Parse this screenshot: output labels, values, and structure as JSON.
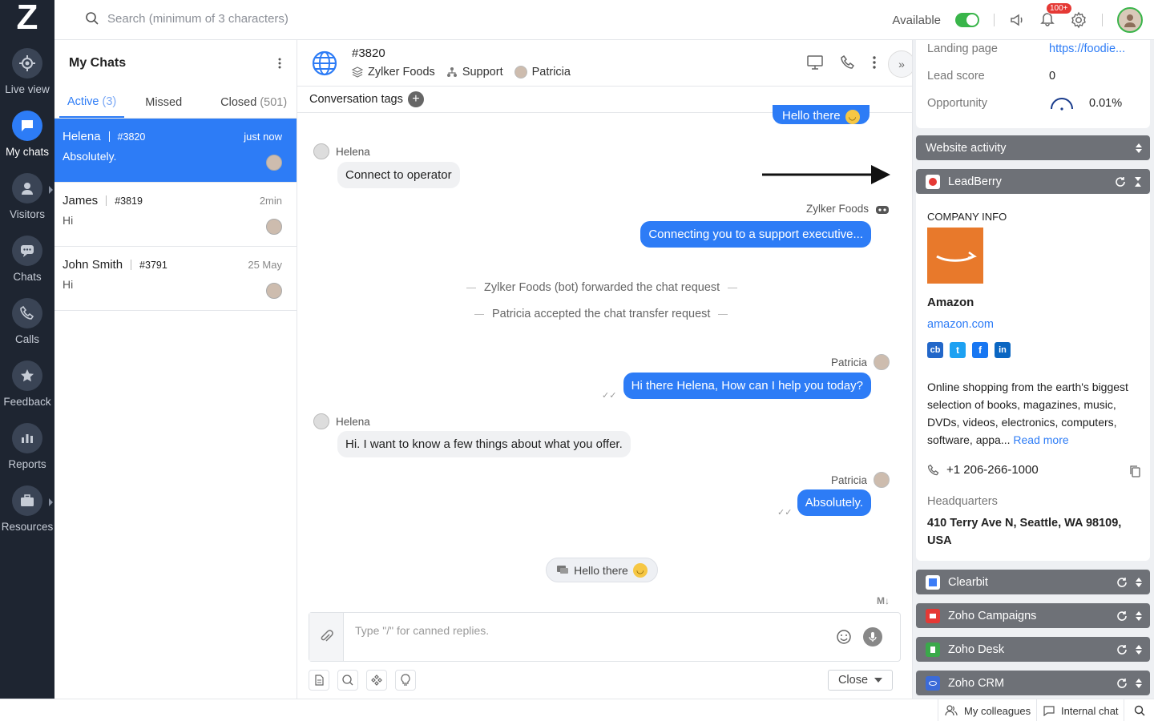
{
  "rail": {
    "logo": "Z",
    "items": [
      {
        "label": "Live view",
        "icon": "crosshair-icon"
      },
      {
        "label": "My chats",
        "icon": "chat-icon"
      },
      {
        "label": "Visitors",
        "icon": "user-icon"
      },
      {
        "label": "Chats",
        "icon": "chat-bubble-icon"
      },
      {
        "label": "Calls",
        "icon": "phone-icon"
      },
      {
        "label": "Feedback",
        "icon": "star-icon"
      },
      {
        "label": "Reports",
        "icon": "bar-chart-icon"
      },
      {
        "label": "Resources",
        "icon": "briefcase-icon"
      }
    ]
  },
  "topbar": {
    "search_placeholder": "Search (minimum of 3 characters)",
    "status_label": "Available",
    "notification_badge": "100+"
  },
  "chatlist": {
    "title": "My Chats",
    "tabs": [
      {
        "label": "Active",
        "count": "(3)"
      },
      {
        "label": "Missed",
        "count": ""
      },
      {
        "label": "Closed",
        "count": "(501)"
      }
    ],
    "items": [
      {
        "name": "Helena",
        "id": "#3820",
        "time": "just now",
        "message": "Absolutely."
      },
      {
        "name": "James",
        "id": "#3819",
        "time": "2min",
        "message": "Hi"
      },
      {
        "name": "John Smith",
        "id": "#3791",
        "time": "25 May",
        "message": "Hi"
      }
    ]
  },
  "conversation": {
    "title": "#3820",
    "brand": "Zylker Foods",
    "department": "Support",
    "operator": "Patricia",
    "tags_label": "Conversation tags",
    "messages": {
      "top_partial": "Hello there",
      "helena1_sender": "Helena",
      "helena1_text": "Connect to operator",
      "bot_sender": "Zylker Foods",
      "bot_text": "Connecting you to a support executive...",
      "sys1": "Zylker Foods (bot) forwarded the chat request",
      "sys2": "Patricia accepted the chat transfer request",
      "patricia1_sender": "Patricia",
      "patricia1_text": "Hi there Helena, How can I help you today?",
      "helena2_sender": "Helena",
      "helena2_text": "Hi. I want to know a few things about what you offer.",
      "patricia2_sender": "Patricia",
      "patricia2_text": "Absolutely.",
      "pill_text": "Hello there"
    },
    "markdown_label": "M↓",
    "composer_placeholder": "Type \"/\" for canned replies.",
    "close_label": "Close"
  },
  "rightpanel": {
    "landing_page_label": "Landing page",
    "landing_page_value": "https://foodie...",
    "lead_score_label": "Lead score",
    "lead_score_value": "0",
    "opportunity_label": "Opportunity",
    "opportunity_value": "0.01%",
    "website_activity": "Website activity",
    "leadberry": "LeadBerry",
    "company_info": "COMPANY INFO",
    "company_name": "Amazon",
    "company_url": "amazon.com",
    "social": [
      "cb",
      "t",
      "f",
      "in"
    ],
    "description": "Online shopping from the earth's biggest selection of books, magazines, music, DVDs, videos, electronics, computers, software, appa...",
    "read_more": "Read more",
    "phone": "+1 206-266-1000",
    "hq_label": "Headquarters",
    "hq_value": "410 Terry Ave N, Seattle, WA 98109, USA",
    "integrations": [
      "Clearbit",
      "Zoho Campaigns",
      "Zoho Desk",
      "Zoho CRM"
    ]
  },
  "bottombar": {
    "colleagues": "My colleagues",
    "internal_chat": "Internal chat"
  },
  "colors": {
    "accent": "#2d7cf6",
    "rail": "#1e2531",
    "online": "#39b54a",
    "amazon": "#e8792b"
  }
}
